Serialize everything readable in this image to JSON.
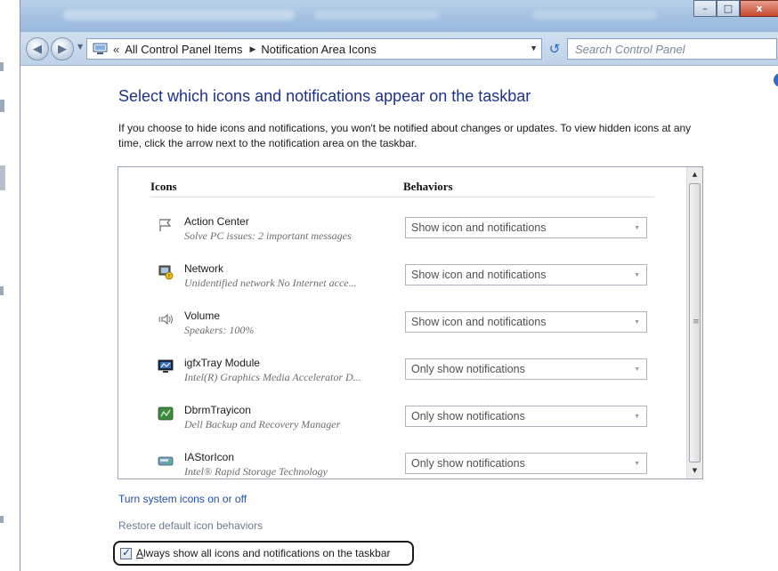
{
  "window": {
    "caption_buttons": {
      "minimize": "–",
      "maximize": "□",
      "close": "x"
    }
  },
  "navbar": {
    "back_glyph": "◀",
    "forward_glyph": "▶",
    "address_prefix": "«",
    "breadcrumbs": [
      "All Control Panel Items",
      "Notification Area Icons"
    ],
    "search_placeholder": "Search Control Panel",
    "address_icon": "computer-icon",
    "refresh_icon": "refresh-icon",
    "search_icon": "magnifier-icon"
  },
  "page": {
    "title": "Select which icons and notifications appear on the taskbar",
    "description": "If you choose to hide icons and notifications, you won't be notified about changes or updates. To view hidden icons at any time, click the arrow next to the notification area on the taskbar."
  },
  "list": {
    "header_icons": "Icons",
    "header_behaviors": "Behaviors",
    "rows": [
      {
        "name": "Action Center",
        "sub": "Solve PC issues: 2 important messages",
        "behavior": "Show icon and notifications",
        "icon": "flag-icon"
      },
      {
        "name": "Network",
        "sub": "Unidentified network No Internet acce...",
        "behavior": "Show icon and notifications",
        "icon": "network-icon"
      },
      {
        "name": "Volume",
        "sub": "Speakers: 100%",
        "behavior": "Show icon and notifications",
        "icon": "speaker-icon"
      },
      {
        "name": "igfxTray Module",
        "sub": "Intel(R) Graphics Media Accelerator D...",
        "behavior": "Only show notifications",
        "icon": "monitor-icon"
      },
      {
        "name": "DbrmTrayicon",
        "sub": "Dell Backup and Recovery Manager",
        "behavior": "Only show notifications",
        "icon": "backup-icon"
      },
      {
        "name": "IAStorIcon",
        "sub": "Intel® Rapid Storage Technology",
        "behavior": "Only show notifications",
        "icon": "storage-icon"
      }
    ]
  },
  "links": {
    "system_icons": "Turn system icons on or off",
    "restore_defaults": "Restore default icon behaviors"
  },
  "always_show": {
    "accesskey": "A",
    "label_rest": "lways show all icons and notifications on the taskbar",
    "checked": true
  },
  "colors": {
    "title_blue": "#1e3287",
    "link_blue": "#1c4fa6",
    "muted_link": "#6e7c90"
  }
}
